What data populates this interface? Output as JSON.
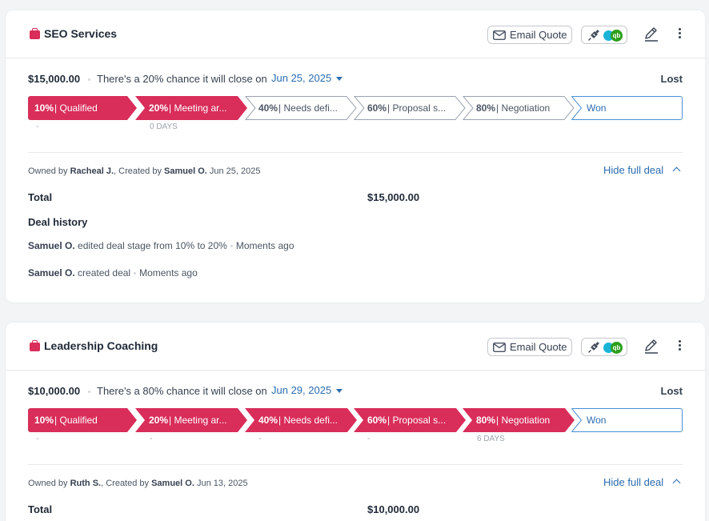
{
  "deals": [
    {
      "title": "SEO Services",
      "email_quote_label": "Email Quote",
      "amount": "$15,000.00",
      "chance_text": "There's a 20% chance it will close on",
      "close_date": "Jun 25, 2025",
      "status": "Lost",
      "stages": [
        {
          "pct": "10%",
          "name": "Qualified",
          "sub": "-"
        },
        {
          "pct": "20%",
          "name": "Meeting ar...",
          "sub": "0 DAYS"
        },
        {
          "pct": "40%",
          "name": "Needs defi...",
          "sub": ""
        },
        {
          "pct": "60%",
          "name": "Proposal s...",
          "sub": ""
        },
        {
          "pct": "80%",
          "name": "Negotiation",
          "sub": ""
        }
      ],
      "won_label": "Won",
      "owned_label": "Owned by",
      "owner": "Racheal J.",
      "created_label": "Created by",
      "creator": "Samuel O.",
      "created_date": "Jun 25, 2025",
      "hide_label": "Hide full deal",
      "total_label": "Total",
      "total_value": "$15,000.00",
      "history_title": "Deal history",
      "history": [
        {
          "user": "Samuel O.",
          "action": "edited deal stage from 10% to 20%",
          "time": "Moments ago"
        },
        {
          "user": "Samuel O.",
          "action": "created deal",
          "time": "Moments ago"
        }
      ]
    },
    {
      "title": "Leadership Coaching",
      "email_quote_label": "Email Quote",
      "amount": "$10,000.00",
      "chance_text": "There's a 80% chance it will close on",
      "close_date": "Jun 29, 2025",
      "status": "Lost",
      "stages": [
        {
          "pct": "10%",
          "name": "Qualified",
          "sub": "-"
        },
        {
          "pct": "20%",
          "name": "Meeting ar...",
          "sub": "-"
        },
        {
          "pct": "40%",
          "name": "Needs defi...",
          "sub": "-"
        },
        {
          "pct": "60%",
          "name": "Proposal s...",
          "sub": "-"
        },
        {
          "pct": "80%",
          "name": "Negotiation",
          "sub": "6 DAYS"
        }
      ],
      "won_label": "Won",
      "owned_label": "Owned by",
      "owner": "Ruth S.",
      "created_label": "Created by",
      "creator": "Samuel O.",
      "created_date": "Jun 13, 2025",
      "hide_label": "Hide full deal",
      "total_label": "Total",
      "total_value": "$10,000.00"
    }
  ],
  "integrations": {
    "xero": "xero",
    "qb": "qb"
  },
  "colors": {
    "active_stage": "#d92d5a",
    "link": "#2b6cb0",
    "won_border": "#4a90d9"
  }
}
